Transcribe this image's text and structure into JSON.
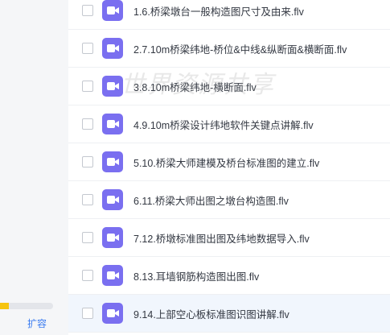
{
  "sidebar": {
    "storage_usage_fraction": 0.17,
    "storage_fill_color": "#f6c40f",
    "expand_label": "扩容"
  },
  "file_icon": "video-file-icon",
  "file_icon_color": "#7a6ff0",
  "files": [
    {
      "name": "1.6.桥梁墩台一般构造图尺寸及由来.flv"
    },
    {
      "name": "2.7.10m桥梁纬地-桥位&中线&纵断面&横断面.flv"
    },
    {
      "name": "3.8.10m桥梁纬地-横断面.flv"
    },
    {
      "name": "4.9.10m桥梁设计纬地软件关键点讲解.flv"
    },
    {
      "name": "5.10.桥梁大师建模及桥台标准图的建立.flv"
    },
    {
      "name": "6.11.桥梁大师出图之墩台构造图.flv"
    },
    {
      "name": "7.12.桥墩标准图出图及纬地数据导入.flv"
    },
    {
      "name": "8.13.耳墙钢筋构造图出图.flv"
    },
    {
      "name": "9.14.上部空心板标准图识图讲解.flv"
    }
  ],
  "hovered_row_index": 8,
  "watermark_text": "世界资源共享"
}
